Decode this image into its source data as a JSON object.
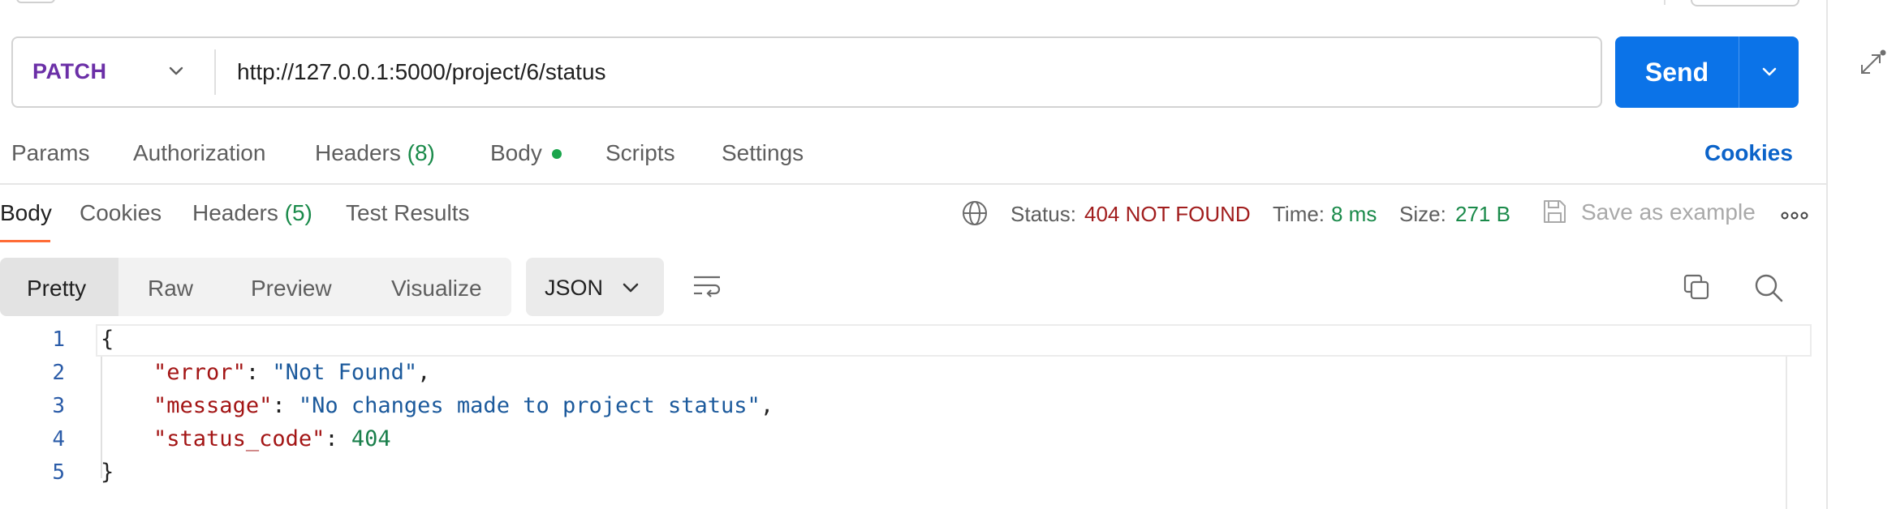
{
  "request": {
    "method": "PATCH",
    "url": "http://127.0.0.1:5000/project/6/status",
    "send_label": "Send"
  },
  "request_tabs": {
    "params": "Params",
    "authorization": "Authorization",
    "headers": "Headers",
    "headers_count": "(8)",
    "body": "Body",
    "scripts": "Scripts",
    "settings": "Settings",
    "cookies_link": "Cookies"
  },
  "response_tabs": {
    "body": "Body",
    "cookies": "Cookies",
    "headers": "Headers",
    "headers_count": "(5)",
    "test_results": "Test Results"
  },
  "response_meta": {
    "status_label": "Status:",
    "status_value": "404 NOT FOUND",
    "time_label": "Time:",
    "time_value": "8 ms",
    "size_label": "Size:",
    "size_value": "271 B",
    "save_label": "Save as example"
  },
  "view_modes": {
    "pretty": "Pretty",
    "raw": "Raw",
    "preview": "Preview",
    "visualize": "Visualize",
    "language": "JSON"
  },
  "code": {
    "line_numbers": [
      "1",
      "2",
      "3",
      "4",
      "5"
    ],
    "open_brace": "{",
    "close_brace": "}",
    "error_key": "\"error\"",
    "error_value": "\"Not Found\"",
    "message_key": "\"message\"",
    "message_value": "\"No changes made to project status\"",
    "status_code_key": "\"status_code\"",
    "status_code_value": "404"
  },
  "colors": {
    "accent_send": "#0b73e8",
    "method_patch": "#6b2fa7",
    "status_error": "#a11d1d",
    "ok_green": "#1a8a4a",
    "tab_underline": "#ff6c37"
  },
  "icons": [
    "expand-icon",
    "globe-icon",
    "save-icon",
    "more-icon",
    "wrap-icon",
    "copy-icon",
    "search-icon",
    "chevron-down-icon"
  ]
}
